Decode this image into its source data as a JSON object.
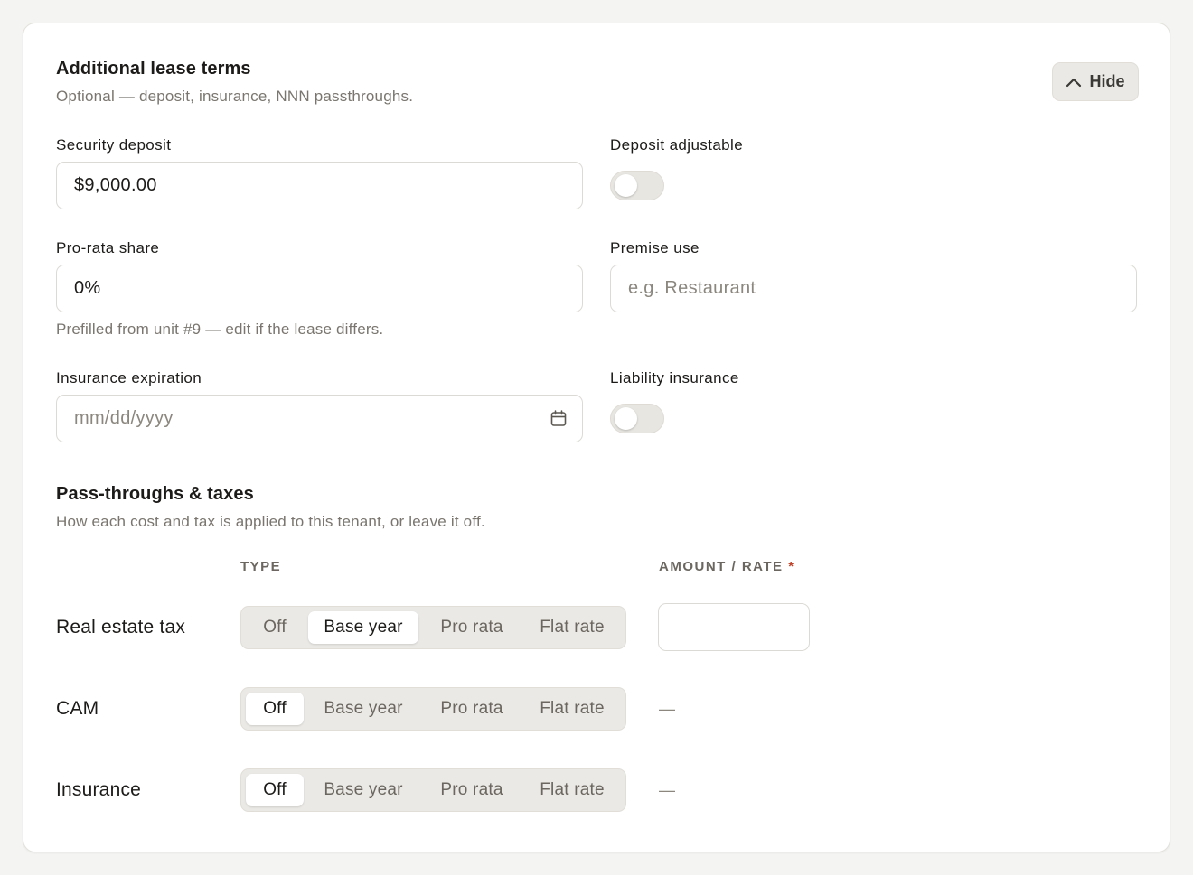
{
  "header": {
    "title": "Additional lease terms",
    "subtitle": "Optional — deposit, insurance, NNN passthroughs.",
    "hide_label": "Hide"
  },
  "fields": {
    "security_deposit": {
      "label": "Security deposit",
      "value": "$9,000.00"
    },
    "deposit_adjustable": {
      "label": "Deposit adjustable",
      "on": false
    },
    "pro_rata_share": {
      "label": "Pro-rata share",
      "value": "0%",
      "hint": "Prefilled from unit #9 — edit if the lease differs."
    },
    "premise_use": {
      "label": "Premise use",
      "placeholder": "e.g. Restaurant"
    },
    "insurance_expiration": {
      "label": "Insurance expiration",
      "placeholder": "mm/dd/yyyy"
    },
    "liability_insurance": {
      "label": "Liability insurance",
      "on": false
    }
  },
  "passthroughs": {
    "title": "Pass-throughs & taxes",
    "subtitle": "How each cost and tax is applied to this tenant, or leave it off.",
    "col_type": "TYPE",
    "col_amount": "AMOUNT / RATE",
    "required_mark": "*",
    "options": [
      "Off",
      "Base year",
      "Pro rata",
      "Flat rate"
    ],
    "rows": [
      {
        "label": "Real estate tax",
        "selected": "Base year",
        "amount": ""
      },
      {
        "label": "CAM",
        "selected": "Off",
        "amount": "—"
      },
      {
        "label": "Insurance",
        "selected": "Off",
        "amount": "—"
      }
    ]
  },
  "icons": {
    "hide": "chevron-up-icon",
    "date": "calendar-icon"
  }
}
